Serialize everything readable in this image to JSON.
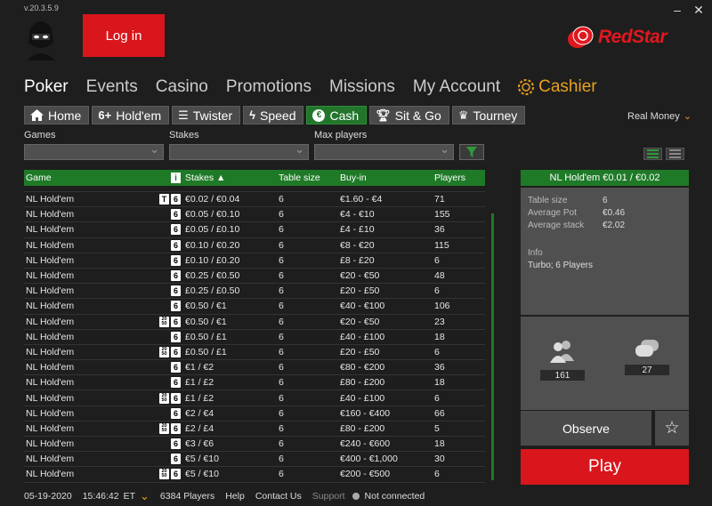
{
  "version": "v.20.3.5.9",
  "login_label": "Log in",
  "brand": {
    "name": "RedStar",
    "color": "#e0181e"
  },
  "main_nav": [
    "Poker",
    "Events",
    "Casino",
    "Promotions",
    "Missions",
    "My Account"
  ],
  "cashier_label": "Cashier",
  "sub_tabs": [
    {
      "label": "Home",
      "icon": "home-icon"
    },
    {
      "label": "Hold'em",
      "icon": "six-plus-icon",
      "prefix": "6+"
    },
    {
      "label": "Twister",
      "icon": "twister-icon"
    },
    {
      "label": "Speed",
      "icon": "lightning-icon"
    },
    {
      "label": "Cash",
      "icon": "euro-icon"
    },
    {
      "label": "Sit & Go",
      "icon": "trophy-icon"
    },
    {
      "label": "Tourney",
      "icon": "cup-icon"
    }
  ],
  "real_money_label": "Real Money",
  "filters": {
    "games": "Games",
    "stakes": "Stakes",
    "max_players": "Max players"
  },
  "table": {
    "headers": {
      "game": "Game",
      "info": "i",
      "stakes": "Stakes ▲",
      "size": "Table size",
      "buyin": "Buy-in",
      "players": "Players"
    },
    "rows": [
      {
        "game": "NL Hold'em",
        "badges": [
          "T",
          "6"
        ],
        "stakes": "€0.02 / €0.04",
        "size": "6",
        "buyin": "€1.60 - €4",
        "players": "71"
      },
      {
        "game": "NL Hold'em",
        "badges": [
          "6"
        ],
        "stakes": "€0.05 / €0.10",
        "size": "6",
        "buyin": "€4 - €10",
        "players": "155"
      },
      {
        "game": "NL Hold'em",
        "badges": [
          "6"
        ],
        "stakes": "£0.05 / £0.10",
        "size": "6",
        "buyin": "£4 - £10",
        "players": "36"
      },
      {
        "game": "NL Hold'em",
        "badges": [
          "6"
        ],
        "stakes": "€0.10 / €0.20",
        "size": "6",
        "buyin": "€8 - €20",
        "players": "115"
      },
      {
        "game": "NL Hold'em",
        "badges": [
          "6"
        ],
        "stakes": "£0.10 / £0.20",
        "size": "6",
        "buyin": "£8 - £20",
        "players": "6"
      },
      {
        "game": "NL Hold'em",
        "badges": [
          "6"
        ],
        "stakes": "€0.25 / €0.50",
        "size": "6",
        "buyin": "€20 - €50",
        "players": "48"
      },
      {
        "game": "NL Hold'em",
        "badges": [
          "6"
        ],
        "stakes": "£0.25 / £0.50",
        "size": "6",
        "buyin": "£20 - £50",
        "players": "6"
      },
      {
        "game": "NL Hold'em",
        "badges": [
          "6"
        ],
        "stakes": "€0.50 / €1",
        "size": "6",
        "buyin": "€40 - €100",
        "players": "106"
      },
      {
        "game": "NL Hold'em",
        "badges": [
          "2050",
          "6"
        ],
        "stakes": "€0.50 / €1",
        "size": "6",
        "buyin": "€20 - €50",
        "players": "23"
      },
      {
        "game": "NL Hold'em",
        "badges": [
          "6"
        ],
        "stakes": "£0.50 / £1",
        "size": "6",
        "buyin": "£40 - £100",
        "players": "18"
      },
      {
        "game": "NL Hold'em",
        "badges": [
          "2050",
          "6"
        ],
        "stakes": "£0.50 / £1",
        "size": "6",
        "buyin": "£20 - £50",
        "players": "6"
      },
      {
        "game": "NL Hold'em",
        "badges": [
          "6"
        ],
        "stakes": "€1 / €2",
        "size": "6",
        "buyin": "€80 - €200",
        "players": "36"
      },
      {
        "game": "NL Hold'em",
        "badges": [
          "6"
        ],
        "stakes": "£1 / £2",
        "size": "6",
        "buyin": "£80 - £200",
        "players": "18"
      },
      {
        "game": "NL Hold'em",
        "badges": [
          "2050",
          "6"
        ],
        "stakes": "£1 / £2",
        "size": "6",
        "buyin": "£40 - £100",
        "players": "6"
      },
      {
        "game": "NL Hold'em",
        "badges": [
          "6"
        ],
        "stakes": "€2 / €4",
        "size": "6",
        "buyin": "€160 - €400",
        "players": "66"
      },
      {
        "game": "NL Hold'em",
        "badges": [
          "2050",
          "6"
        ],
        "stakes": "£2 / £4",
        "size": "6",
        "buyin": "£80 - £200",
        "players": "5"
      },
      {
        "game": "NL Hold'em",
        "badges": [
          "6"
        ],
        "stakes": "€3 / €6",
        "size": "6",
        "buyin": "€240 - €600",
        "players": "18"
      },
      {
        "game": "NL Hold'em",
        "badges": [
          "6"
        ],
        "stakes": "€5 / €10",
        "size": "6",
        "buyin": "€400 - €1,000",
        "players": "30"
      },
      {
        "game": "NL Hold'em",
        "badges": [
          "2050",
          "6"
        ],
        "stakes": "€5 / €10",
        "size": "6",
        "buyin": "€200 - €500",
        "players": "6"
      }
    ]
  },
  "detail": {
    "title": "NL Hold'em €0.01 / €0.02",
    "table_size_label": "Table size",
    "table_size": "6",
    "avg_pot_label": "Average Pot",
    "avg_pot": "€0.46",
    "avg_stack_label": "Average stack",
    "avg_stack": "€2.02",
    "info_label": "Info",
    "info": "Turbo; 6 Players",
    "players_count": "161",
    "tables_count": "27"
  },
  "observe_label": "Observe",
  "play_label": "Play",
  "status": {
    "date": "05-19-2020",
    "time": "15:46:42",
    "tz": "ET",
    "players": "6384 Players",
    "help": "Help",
    "contact": "Contact Us",
    "support": "Support",
    "connection": "Not connected"
  },
  "colors": {
    "green": "#1f7a28",
    "red": "#d9161c",
    "gold": "#e8a020"
  }
}
